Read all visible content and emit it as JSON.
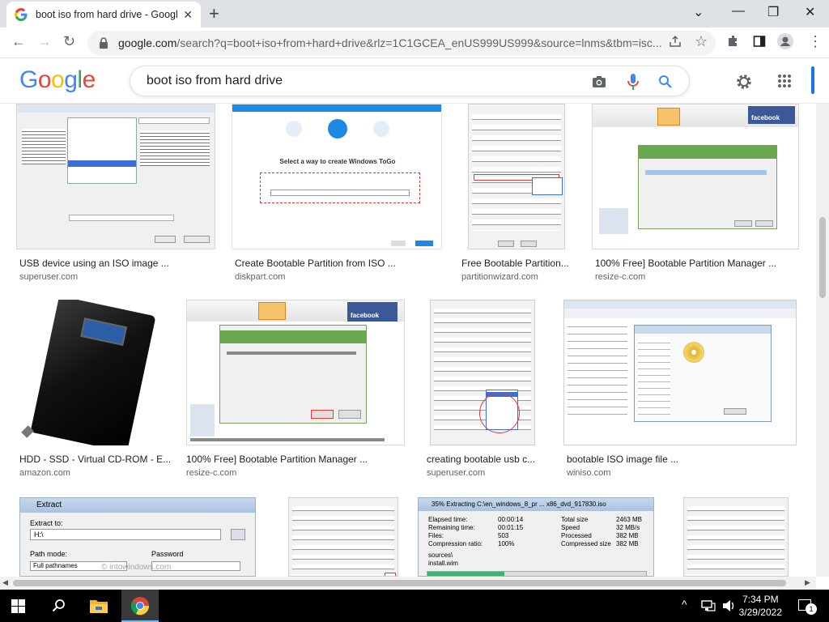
{
  "browser": {
    "tab_title": "boot iso from hard drive - Googl",
    "url_domain": "google.com",
    "url_rest": "/search?q=boot+iso+from+hard+drive&rlz=1C1GCEA_enUS999US999&source=lnms&tbm=isc..."
  },
  "google": {
    "logo": "Google",
    "query": "boot iso from hard drive"
  },
  "results": [
    {
      "caption": "USB device using an ISO image ...",
      "source": "superuser.com"
    },
    {
      "caption": "Create Bootable Partition from ISO ...",
      "source": "diskpart.com"
    },
    {
      "caption": "Free Bootable Partition...",
      "source": "partitionwizard.com"
    },
    {
      "caption": "100% Free] Bootable Partition Manager ...",
      "source": "resize-c.com"
    },
    {
      "caption": "HDD - SSD - Virtual CD-ROM - E...",
      "source": "amazon.com"
    },
    {
      "caption": "100% Free] Bootable Partition Manager ...",
      "source": "resize-c.com"
    },
    {
      "caption": "creating bootable usb c...",
      "source": "superuser.com"
    },
    {
      "caption": "bootable ISO image file ...",
      "source": "winiso.com"
    }
  ],
  "thumb_text": {
    "togo_title": "Select a way to create Windows ToGo",
    "facebook": "facebook",
    "extract_title": "Extract",
    "extract_to": "Extract to:",
    "extract_path": "H:\\",
    "path_mode": "Path mode:",
    "password": "Password",
    "full_pathnames": "Full pathnames",
    "watermark": "© intowindows.com",
    "progress_title": "35% Extracting C:\\en_windows_8_pr ... x86_dvd_917830.iso",
    "elapsed": "Elapsed time:",
    "remaining": "Remaining time:",
    "files": "Files:",
    "compression": "Compression ratio:",
    "total_size": "Total size",
    "speed": "Speed",
    "processed": "Processed",
    "compressed_size": "Compressed size",
    "elapsed_v": "00:00:14",
    "remaining_v": "00:01:15",
    "files_v": "503",
    "ratio_v": "100%",
    "total_v": "2463 MB",
    "speed_v": "32 MB/s",
    "processed_v": "382 MB",
    "compressed_v": "382 MB",
    "source_label": "sources\\",
    "source_file": "install.wim"
  },
  "taskbar": {
    "time": "7:34 PM",
    "date": "3/29/2022",
    "notifications": "1"
  },
  "colors": {
    "google_blue": "#4285f4",
    "google_red": "#ea4335",
    "google_yellow": "#fbbc05",
    "google_green": "#34a853",
    "taskbar": "#000000"
  }
}
